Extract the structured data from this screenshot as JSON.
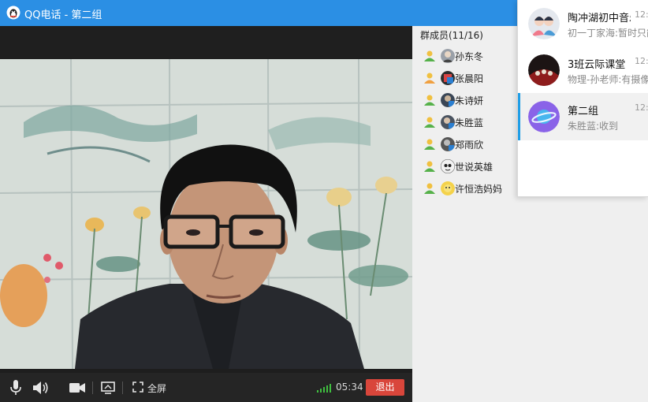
{
  "window": {
    "title": "QQ电话 - 第二组",
    "logo_icon": "qq-penguin-icon",
    "accent_color": "#2b8fe4"
  },
  "controls": {
    "mic_icon": "microphone-icon",
    "speaker_icon": "speaker-icon",
    "camera_icon": "video-camera-icon",
    "share_icon": "screen-share-icon",
    "fullscreen_icon": "fullscreen-icon",
    "fullscreen_label": "全屏",
    "signal_icon": "signal-strength-icon",
    "timer": "05:34",
    "exit_label": "退出",
    "exit_color": "#d9463b"
  },
  "members": {
    "title": "群成员(11/16)",
    "items": [
      {
        "name": "孙东冬"
      },
      {
        "name": "张晨阳"
      },
      {
        "name": "朱诗妍"
      },
      {
        "name": "朱胜蓝"
      },
      {
        "name": "郑雨欣"
      },
      {
        "name": "世说英雄"
      },
      {
        "name": "许恒浩妈妈"
      }
    ]
  },
  "popup": {
    "conversations": [
      {
        "name": "陶冲湖初中音乐",
        "time": "12:",
        "message": "初一丁家海:暂时只能"
      },
      {
        "name": "3班云际课堂",
        "time": "12:",
        "message": "物理-孙老师:有摄像头"
      },
      {
        "name": "第二组",
        "time": "12:",
        "message": "朱胜蓝:收到"
      }
    ]
  }
}
